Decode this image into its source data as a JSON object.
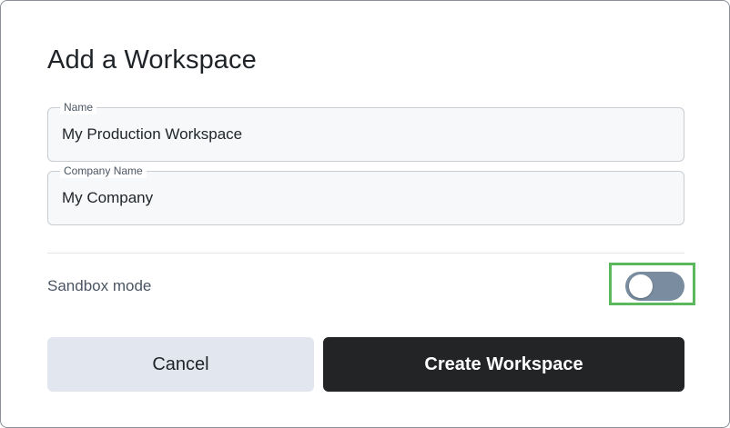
{
  "dialog": {
    "title": "Add a Workspace",
    "fields": {
      "name": {
        "label": "Name",
        "value": "My Production Workspace"
      },
      "company": {
        "label": "Company Name",
        "value": "My Company"
      }
    },
    "sandbox": {
      "label": "Sandbox mode",
      "enabled": false
    },
    "buttons": {
      "cancel_label": "Cancel",
      "create_label": "Create Workspace"
    },
    "colors": {
      "toggle_track": "#7a8da0",
      "highlight": "#5cb85c",
      "primary_button": "#222426",
      "secondary_button": "#e2e6ee"
    }
  }
}
